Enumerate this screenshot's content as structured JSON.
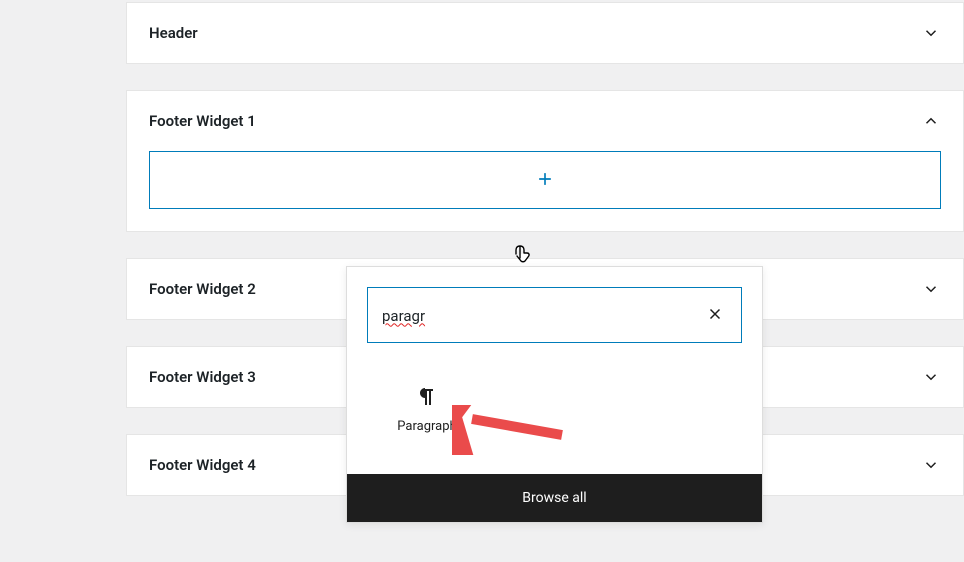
{
  "panels": [
    {
      "title": "Header",
      "expanded": false
    },
    {
      "title": "Footer Widget 1",
      "expanded": true
    },
    {
      "title": "Footer Widget 2",
      "expanded": false
    },
    {
      "title": "Footer Widget 3",
      "expanded": false
    },
    {
      "title": "Footer Widget 4",
      "expanded": false
    }
  ],
  "inserter": {
    "search_value": "paragr",
    "results": [
      {
        "label": "Paragraph",
        "icon": "pilcrow"
      }
    ],
    "browse_all_label": "Browse all"
  }
}
